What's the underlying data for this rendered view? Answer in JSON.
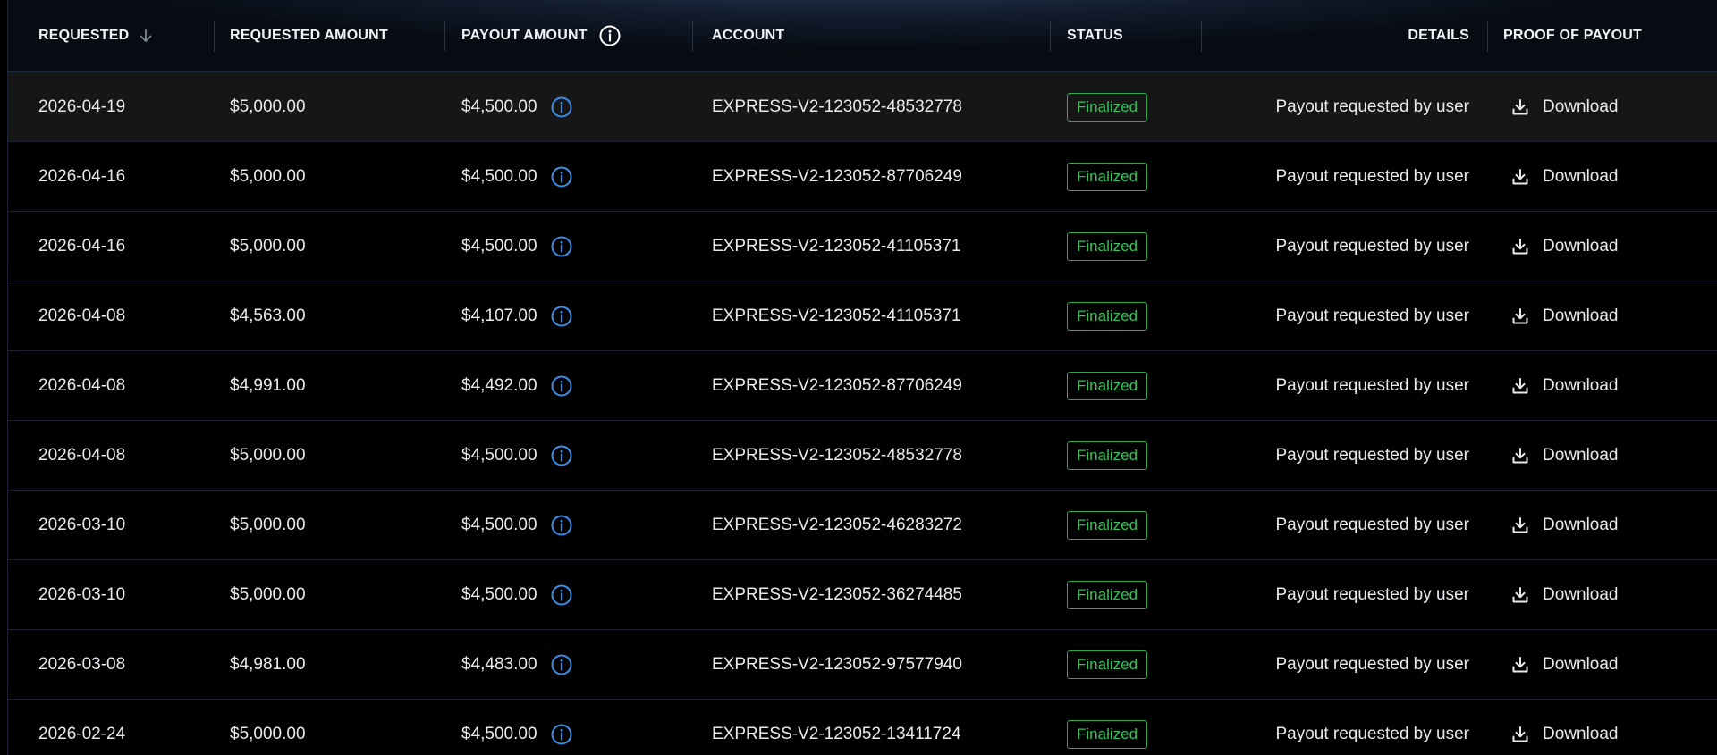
{
  "headers": {
    "requested": "REQUESTED",
    "requested_amount": "REQUESTED AMOUNT",
    "payout_amount": "PAYOUT AMOUNT",
    "account": "ACCOUNT",
    "status": "STATUS",
    "details": "DETAILS",
    "proof": "PROOF OF PAYOUT"
  },
  "sort": {
    "column": "requested",
    "direction": "descending"
  },
  "colors": {
    "status_green": "#35c25a",
    "info_blue": "#3b8ee8",
    "header_bg": "#121c2d"
  },
  "rows": [
    {
      "requested": "2026-04-19",
      "requested_amount": "$5,000.00",
      "payout_amount": "$4,500.00",
      "account": "EXPRESS-V2-123052-48532778",
      "status": "Finalized",
      "details": "Payout requested by user",
      "proof": "Download"
    },
    {
      "requested": "2026-04-16",
      "requested_amount": "$5,000.00",
      "payout_amount": "$4,500.00",
      "account": "EXPRESS-V2-123052-87706249",
      "status": "Finalized",
      "details": "Payout requested by user",
      "proof": "Download"
    },
    {
      "requested": "2026-04-16",
      "requested_amount": "$5,000.00",
      "payout_amount": "$4,500.00",
      "account": "EXPRESS-V2-123052-41105371",
      "status": "Finalized",
      "details": "Payout requested by user",
      "proof": "Download"
    },
    {
      "requested": "2026-04-08",
      "requested_amount": "$4,563.00",
      "payout_amount": "$4,107.00",
      "account": "EXPRESS-V2-123052-41105371",
      "status": "Finalized",
      "details": "Payout requested by user",
      "proof": "Download"
    },
    {
      "requested": "2026-04-08",
      "requested_amount": "$4,991.00",
      "payout_amount": "$4,492.00",
      "account": "EXPRESS-V2-123052-87706249",
      "status": "Finalized",
      "details": "Payout requested by user",
      "proof": "Download"
    },
    {
      "requested": "2026-04-08",
      "requested_amount": "$5,000.00",
      "payout_amount": "$4,500.00",
      "account": "EXPRESS-V2-123052-48532778",
      "status": "Finalized",
      "details": "Payout requested by user",
      "proof": "Download"
    },
    {
      "requested": "2026-03-10",
      "requested_amount": "$5,000.00",
      "payout_amount": "$4,500.00",
      "account": "EXPRESS-V2-123052-46283272",
      "status": "Finalized",
      "details": "Payout requested by user",
      "proof": "Download"
    },
    {
      "requested": "2026-03-10",
      "requested_amount": "$5,000.00",
      "payout_amount": "$4,500.00",
      "account": "EXPRESS-V2-123052-36274485",
      "status": "Finalized",
      "details": "Payout requested by user",
      "proof": "Download"
    },
    {
      "requested": "2026-03-08",
      "requested_amount": "$4,981.00",
      "payout_amount": "$4,483.00",
      "account": "EXPRESS-V2-123052-97577940",
      "status": "Finalized",
      "details": "Payout requested by user",
      "proof": "Download"
    },
    {
      "requested": "2026-02-24",
      "requested_amount": "$5,000.00",
      "payout_amount": "$4,500.00",
      "account": "EXPRESS-V2-123052-13411724",
      "status": "Finalized",
      "details": "Payout requested by user",
      "proof": "Download"
    }
  ]
}
